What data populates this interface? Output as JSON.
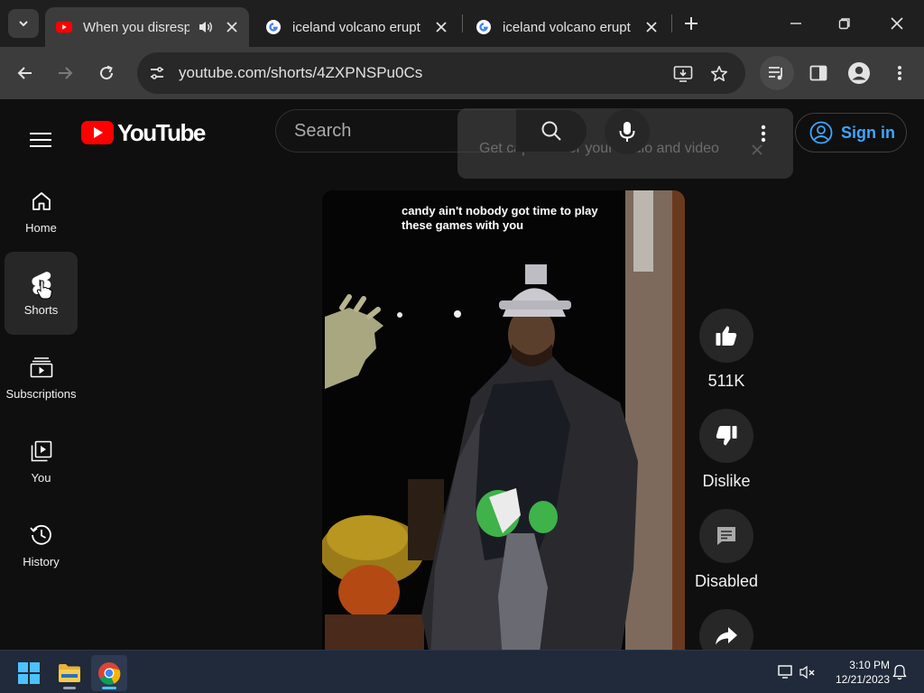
{
  "browser": {
    "tabs": [
      {
        "title": "When you disrespect",
        "active": true,
        "favicon": "youtube-favicon",
        "audio": true
      },
      {
        "title": "iceland volcano erupt",
        "active": false,
        "favicon": "google-favicon"
      },
      {
        "title": "iceland volcano erupt",
        "active": false,
        "favicon": "google-favicon"
      }
    ],
    "url": "youtube.com/shorts/4ZXPNSPu0Cs"
  },
  "youtube": {
    "logo_text": "YouTube",
    "search_placeholder": "Search",
    "caption_popup": "Get captions for your audio and video",
    "signin_label": "Sign in",
    "sidebar": [
      {
        "label": "Home",
        "icon": "home-icon"
      },
      {
        "label": "Shorts",
        "icon": "shorts-icon",
        "active": true
      },
      {
        "label": "Subscriptions",
        "icon": "subscriptions-icon"
      },
      {
        "label": "You",
        "icon": "you-library-icon"
      },
      {
        "label": "History",
        "icon": "history-icon"
      }
    ],
    "video_caption": "candy ain't nobody got time to play these games with you",
    "actions": {
      "like": "511K",
      "dislike": "Dislike",
      "comments": "Disabled"
    }
  },
  "taskbar": {
    "time": "3:10 PM",
    "date": "12/21/2023"
  },
  "colors": {
    "youtube_red": "#ff0000",
    "link_blue": "#3ea6ff",
    "background": "#0f0f0f"
  }
}
